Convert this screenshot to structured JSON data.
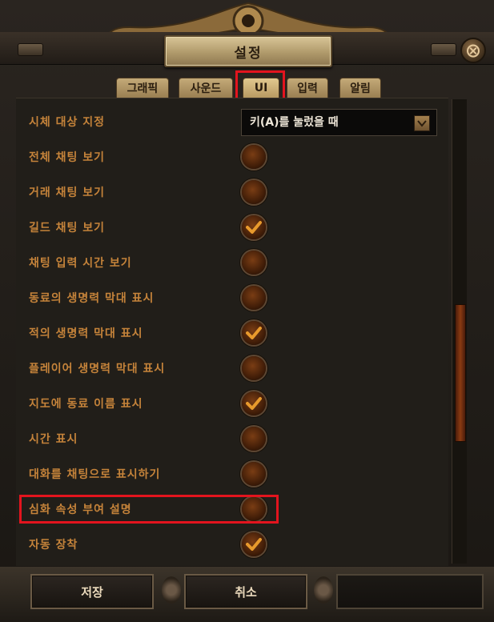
{
  "window": {
    "title": "설정",
    "close_label": "⨂"
  },
  "tabs": [
    {
      "label": "그래픽",
      "active": false
    },
    {
      "label": "사운드",
      "active": false
    },
    {
      "label": "UI",
      "active": true
    },
    {
      "label": "입력",
      "active": false
    },
    {
      "label": "알림",
      "active": false
    }
  ],
  "settings": [
    {
      "label": "시체 대상 지정",
      "control": "dropdown",
      "value": "키(A)를 눌렀을 때"
    },
    {
      "label": "전체 채팅 보기",
      "control": "checkbox",
      "checked": false
    },
    {
      "label": "거래 채팅 보기",
      "control": "checkbox",
      "checked": false
    },
    {
      "label": "길드 채팅 보기",
      "control": "checkbox",
      "checked": true
    },
    {
      "label": "채팅 입력 시간 보기",
      "control": "checkbox",
      "checked": false
    },
    {
      "label": "동료의 생명력 막대 표시",
      "control": "checkbox",
      "checked": false
    },
    {
      "label": "적의 생명력 막대 표시",
      "control": "checkbox",
      "checked": true
    },
    {
      "label": "플레이어 생명력 막대 표시",
      "control": "checkbox",
      "checked": false
    },
    {
      "label": "지도에 동료 이름 표시",
      "control": "checkbox",
      "checked": true
    },
    {
      "label": "시간 표시",
      "control": "checkbox",
      "checked": false
    },
    {
      "label": "대화를 채팅으로 표시하기",
      "control": "checkbox",
      "checked": false
    },
    {
      "label": "심화 속성 부여 설명",
      "control": "checkbox",
      "checked": false
    },
    {
      "label": "자동 장착",
      "control": "checkbox",
      "checked": true
    }
  ],
  "footer": {
    "save_label": "저장",
    "cancel_label": "취소"
  },
  "colors": {
    "label": "#c5833a",
    "highlight": "#e3141e",
    "check": "#e89a2c"
  }
}
